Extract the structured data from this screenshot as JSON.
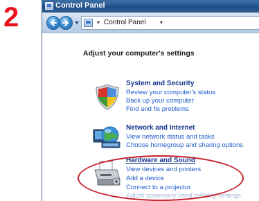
{
  "step_number": "2",
  "window": {
    "title": "Control Panel",
    "address": {
      "crumb": "Control Panel",
      "arrow": "▾"
    }
  },
  "page": {
    "title": "Adjust your computer's settings"
  },
  "categories": [
    {
      "heading": "System and Security",
      "links": [
        "Review your computer's status",
        "Back up your computer",
        "Find and fix problems"
      ]
    },
    {
      "heading": "Network and Internet",
      "links": [
        "View network status and tasks",
        "Choose homegroup and sharing options"
      ]
    },
    {
      "heading": "Hardware and Sound",
      "links": [
        "View devices and printers",
        "Add a device",
        "Connect to a projector",
        "Adjust commonly used mobility settings"
      ]
    }
  ],
  "colors": {
    "step_number": "#e8141c",
    "heading": "#16358f",
    "link": "#1d5ccc",
    "highlight": "#c8202a"
  }
}
